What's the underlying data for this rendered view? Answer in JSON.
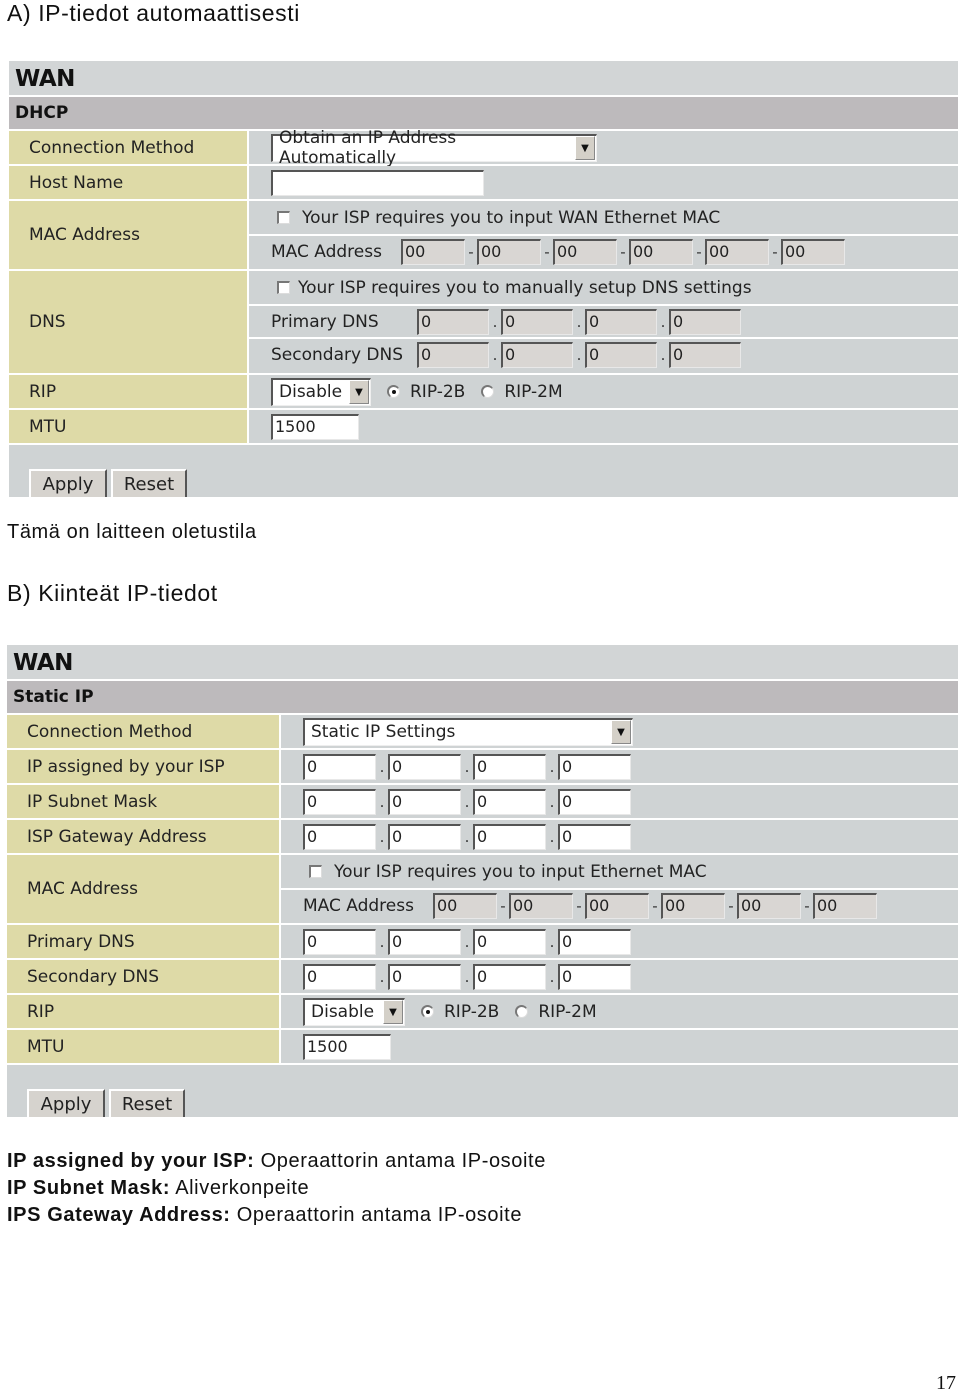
{
  "section_a": {
    "heading": "A) IP-tiedot automaattisesti",
    "panel": {
      "title": "WAN",
      "subtitle": "DHCP",
      "connection_method": {
        "label": "Connection Method",
        "value": "Obtain an IP Address Automatically"
      },
      "host_name": {
        "label": "Host Name",
        "value": ""
      },
      "mac": {
        "label": "MAC Address",
        "checkbox_label": "Your ISP requires you to input WAN Ethernet MAC",
        "checked": false,
        "field_label": "MAC Address",
        "octets": [
          "00",
          "00",
          "00",
          "00",
          "00",
          "00"
        ]
      },
      "dns": {
        "label": "DNS",
        "checkbox_label": "Your ISP requires you to manually setup DNS settings",
        "checked": false,
        "primary_label": "Primary DNS",
        "primary": [
          "0",
          "0",
          "0",
          "0"
        ],
        "secondary_label": "Secondary DNS",
        "secondary": [
          "0",
          "0",
          "0",
          "0"
        ]
      },
      "rip": {
        "label": "RIP",
        "select": "Disable",
        "options": [
          "RIP-2B",
          "RIP-2M"
        ],
        "selected": "RIP-2B"
      },
      "mtu": {
        "label": "MTU",
        "value": "1500"
      },
      "buttons": {
        "apply": "Apply",
        "reset": "Reset"
      }
    },
    "caption": "Tämä on laitteen oletustila"
  },
  "section_b": {
    "heading": "B) Kiinteät IP-tiedot",
    "panel": {
      "title": "WAN",
      "subtitle": "Static IP",
      "connection_method": {
        "label": "Connection Method",
        "value": "Static IP Settings"
      },
      "ip": {
        "label": "IP assigned by your ISP",
        "octets": [
          "0",
          "0",
          "0",
          "0"
        ]
      },
      "mask": {
        "label": "IP Subnet Mask",
        "octets": [
          "0",
          "0",
          "0",
          "0"
        ]
      },
      "gateway": {
        "label": "ISP Gateway Address",
        "octets": [
          "0",
          "0",
          "0",
          "0"
        ]
      },
      "mac": {
        "label": "MAC Address",
        "checkbox_label": "Your ISP requires you to input Ethernet MAC",
        "checked": false,
        "field_label": "MAC Address",
        "octets": [
          "00",
          "00",
          "00",
          "00",
          "00",
          "00"
        ]
      },
      "primary_dns": {
        "label": "Primary DNS",
        "octets": [
          "0",
          "0",
          "0",
          "0"
        ]
      },
      "secondary_dns": {
        "label": "Secondary DNS",
        "octets": [
          "0",
          "0",
          "0",
          "0"
        ]
      },
      "rip": {
        "label": "RIP",
        "select": "Disable",
        "options": [
          "RIP-2B",
          "RIP-2M"
        ],
        "selected": "RIP-2B"
      },
      "mtu": {
        "label": "MTU",
        "value": "1500"
      },
      "buttons": {
        "apply": "Apply",
        "reset": "Reset"
      }
    }
  },
  "glossary": [
    {
      "term": "IP assigned by your ISP:",
      "definition": "Operaattorin antama IP-osoite"
    },
    {
      "term": "IP Subnet Mask:",
      "definition": "Aliverkonpeite"
    },
    {
      "term": "IPS Gateway Address:",
      "definition": "Operaattorin antama IP-osoite"
    }
  ],
  "page_number": "17",
  "icons": {
    "dropdown": "▼"
  }
}
